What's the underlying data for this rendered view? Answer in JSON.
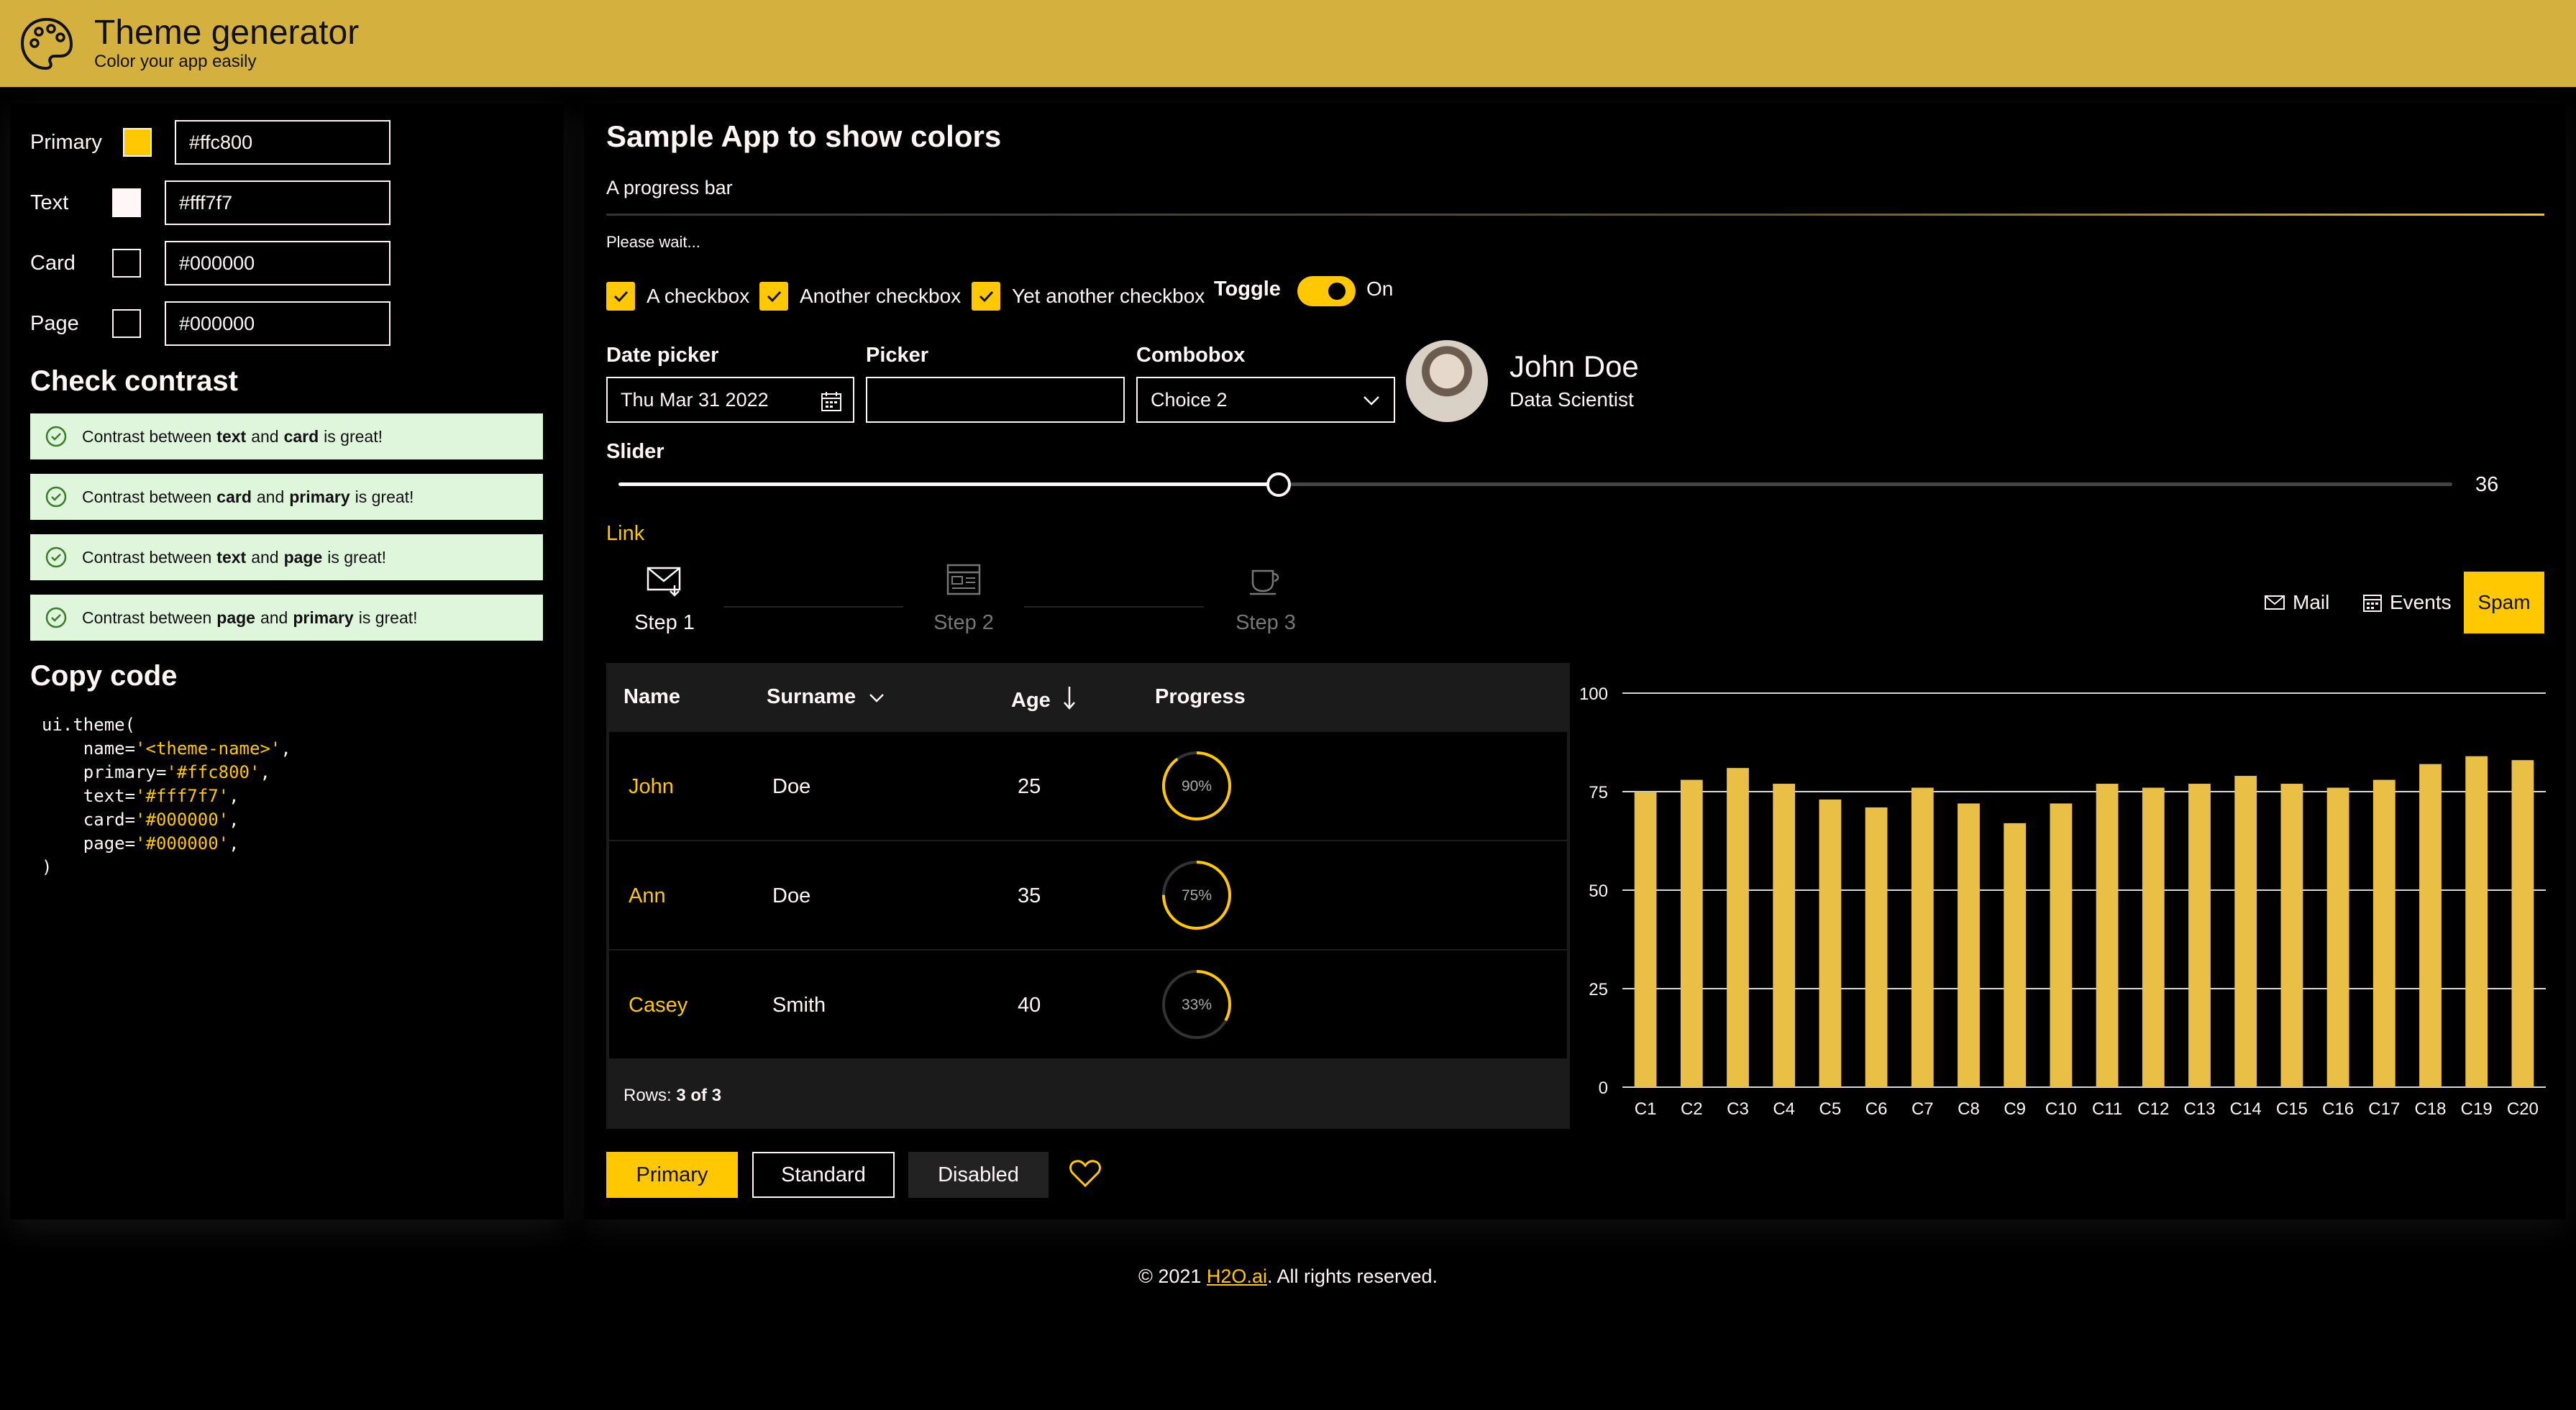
{
  "header": {
    "title": "Theme generator",
    "subtitle": "Color your app easily",
    "logo_icon": "palette-icon",
    "bg_color": "#d4b13f"
  },
  "colors": {
    "fields": [
      {
        "label": "Primary",
        "value": "#ffc800",
        "swatch": "#ffc800"
      },
      {
        "label": "Text",
        "value": "#fff7f7",
        "swatch": "#fff7f7"
      },
      {
        "label": "Card",
        "value": "#000000",
        "swatch": "#000000"
      },
      {
        "label": "Page",
        "value": "#000000",
        "swatch": "#000000"
      }
    ]
  },
  "contrast": {
    "title": "Check contrast",
    "items": [
      {
        "prefix": "Contrast between",
        "a": "text",
        "mid": "and",
        "b": "card",
        "suffix": "is great!"
      },
      {
        "prefix": "Contrast between",
        "a": "card",
        "mid": "and",
        "b": "primary",
        "suffix": "is great!"
      },
      {
        "prefix": "Contrast between",
        "a": "text",
        "mid": "and",
        "b": "page",
        "suffix": "is great!"
      },
      {
        "prefix": "Contrast between",
        "a": "page",
        "mid": "and",
        "b": "primary",
        "suffix": "is great!"
      }
    ]
  },
  "code": {
    "title": "Copy code",
    "line1": "ui.theme(",
    "name_key": "    name=",
    "name_val": "'<theme-name>'",
    "primary_key": "    primary=",
    "primary_val": "'#ffc800'",
    "text_key": "    text=",
    "text_val": "'#fff7f7'",
    "card_key": "    card=",
    "card_val": "'#000000'",
    "page_key": "    page=",
    "page_val": "'#000000'",
    "comma": ",",
    "close": ")"
  },
  "main": {
    "title": "Sample App to show colors",
    "progress_label": "A progress bar",
    "progress_caption": "Please wait...",
    "checkboxes": [
      "A checkbox",
      "Another checkbox",
      "Yet another checkbox"
    ],
    "toggle_label": "Toggle",
    "toggle_state": "On",
    "date_picker": {
      "label": "Date picker",
      "value": "Thu Mar 31 2022"
    },
    "picker": {
      "label": "Picker",
      "value": ""
    },
    "combobox": {
      "label": "Combobox",
      "value": "Choice 2"
    },
    "persona": {
      "name": "John Doe",
      "role": "Data Scientist"
    },
    "slider": {
      "label": "Slider",
      "value": "36",
      "min": 0,
      "max": 100
    },
    "link": "Link",
    "steps": [
      {
        "label": "Step 1",
        "icon": "mail-icon"
      },
      {
        "label": "Step 2",
        "icon": "calendar-icon"
      },
      {
        "label": "Step 3",
        "icon": "coffee-icon"
      }
    ],
    "tabs": [
      {
        "label": "Mail",
        "icon": "mail-icon"
      },
      {
        "label": "Events",
        "icon": "calendar-icon"
      },
      {
        "label": "Spam",
        "icon": ""
      }
    ]
  },
  "table": {
    "columns": [
      "Name",
      "Surname",
      "Age",
      "Progress"
    ],
    "rows": [
      {
        "name": "John",
        "surname": "Doe",
        "age": "25",
        "progress": "90%",
        "pct": 0.9
      },
      {
        "name": "Ann",
        "surname": "Doe",
        "age": "35",
        "progress": "75%",
        "pct": 0.75
      },
      {
        "name": "Casey",
        "surname": "Smith",
        "age": "40",
        "progress": "33%",
        "pct": 0.33
      }
    ],
    "footer_prefix": "Rows:",
    "footer_count": "3 of 3"
  },
  "buttons": {
    "primary": "Primary",
    "standard": "Standard",
    "disabled": "Disabled"
  },
  "chart_data": {
    "type": "bar",
    "categories": [
      "C1",
      "C2",
      "C3",
      "C4",
      "C5",
      "C6",
      "C7",
      "C8",
      "C9",
      "C10",
      "C11",
      "C12",
      "C13",
      "C14",
      "C15",
      "C16",
      "C17",
      "C18",
      "C19",
      "C20"
    ],
    "values": [
      75,
      78,
      81,
      77,
      73,
      71,
      76,
      72,
      67,
      72,
      77,
      76,
      77,
      79,
      77,
      76,
      78,
      82,
      84,
      83
    ],
    "ylim": [
      0,
      100
    ],
    "yticks": [
      0,
      25,
      50,
      75,
      100
    ],
    "title": "",
    "xlabel": "",
    "ylabel": "",
    "color": "#e9bf45",
    "grid": true
  },
  "footer": {
    "prefix": "© 2021",
    "link": "H2O.ai",
    "suffix": ". All rights reserved."
  }
}
